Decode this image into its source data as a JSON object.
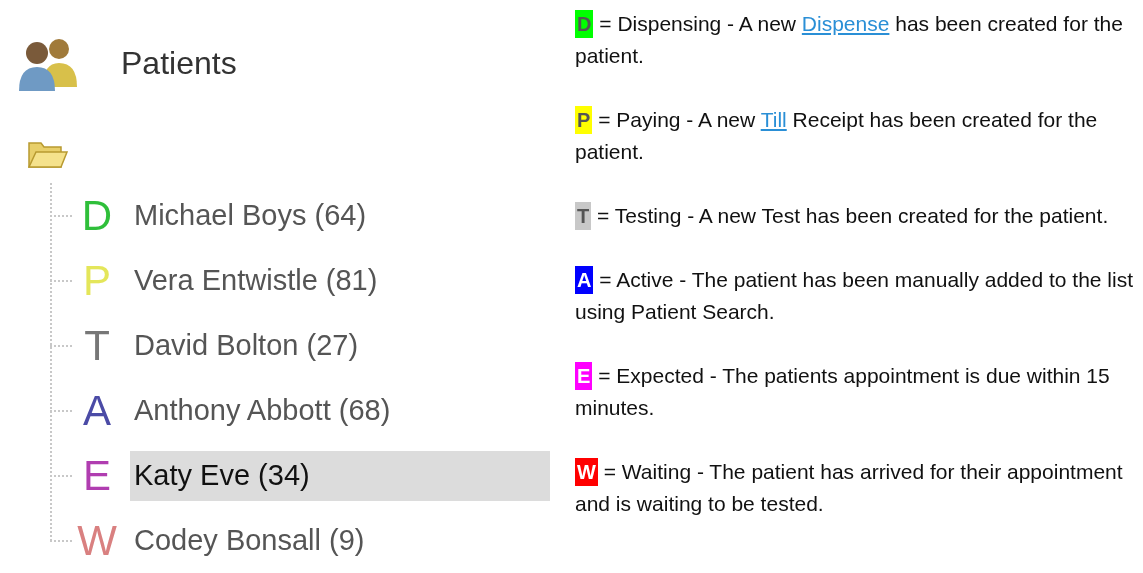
{
  "panel": {
    "title": "Patients"
  },
  "tree": [
    {
      "letter": "D",
      "color": "#2fbf3a",
      "name": "Michael Boys (64)",
      "selected": false
    },
    {
      "letter": "P",
      "color": "#e4e65a",
      "name": "Vera Entwistle (81)",
      "selected": false
    },
    {
      "letter": "T",
      "color": "#777777",
      "name": "David Bolton (27)",
      "selected": false
    },
    {
      "letter": "A",
      "color": "#4b4ba6",
      "name": "Anthony Abbott (68)",
      "selected": false
    },
    {
      "letter": "E",
      "color": "#b03db0",
      "name": "Katy Eve (34)",
      "selected": true
    },
    {
      "letter": "W",
      "color": "#d98080",
      "name": "Codey Bonsall (9)",
      "selected": false
    }
  ],
  "legend": [
    {
      "letter": "D",
      "color": "#00ff00",
      "segments": [
        {
          "kind": "text",
          "text": "= Dispensing - A new"
        },
        {
          "kind": "link",
          "text": "Dispense"
        },
        {
          "kind": "text",
          "text": "has been created for the patient."
        }
      ]
    },
    {
      "letter": "P",
      "color": "#ffff00",
      "segments": [
        {
          "kind": "text",
          "text": "= Paying - A new"
        },
        {
          "kind": "link",
          "text": "Till"
        },
        {
          "kind": "text",
          "text": "Receipt has been created for the patient."
        }
      ]
    },
    {
      "letter": "T",
      "color": "#c8c8c8",
      "segments": [
        {
          "kind": "text",
          "text": "= Testing - A new Test has been created for the patient."
        }
      ]
    },
    {
      "letter": "A",
      "color": "#0000ff",
      "segments": [
        {
          "kind": "text",
          "text": "= Active - The patient has been manually added to the list using Patient Search."
        }
      ]
    },
    {
      "letter": "E",
      "color": "#ff00ff",
      "segments": [
        {
          "kind": "text",
          "text": "= Expected - The patients appointment is due within 15 minutes."
        }
      ]
    },
    {
      "letter": "W",
      "color": "#ff0000",
      "segments": [
        {
          "kind": "text",
          "text": "= Waiting - The patient has arrived for their appointment and is waiting to be tested."
        }
      ]
    }
  ]
}
